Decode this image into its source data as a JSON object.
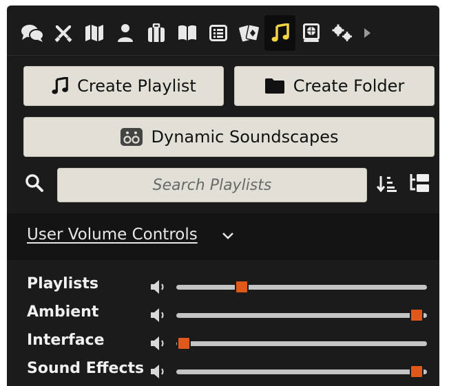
{
  "tabs": [
    {
      "name": "chat-messages-icon",
      "active": false
    },
    {
      "name": "combat-swords-icon",
      "active": false
    },
    {
      "name": "scenes-map-icon",
      "active": false
    },
    {
      "name": "actors-user-icon",
      "active": false
    },
    {
      "name": "items-suitcase-icon",
      "active": false
    },
    {
      "name": "journal-book-icon",
      "active": false
    },
    {
      "name": "tables-list-icon",
      "active": false
    },
    {
      "name": "cards-icon",
      "active": false
    },
    {
      "name": "playlists-music-icon",
      "active": true
    },
    {
      "name": "compendium-atlas-icon",
      "active": false
    },
    {
      "name": "settings-cogs-icon",
      "active": false
    },
    {
      "name": "more-tabs-arrow-icon",
      "active": false
    }
  ],
  "buttons": {
    "create_playlist": "Create Playlist",
    "create_folder": "Create Folder",
    "dynamic_soundscapes": "Dynamic Soundscapes"
  },
  "search": {
    "placeholder": "Search Playlists",
    "value": ""
  },
  "volume": {
    "title": "User Volume Controls",
    "channels": [
      {
        "label": "Playlists",
        "level": 0.26
      },
      {
        "label": "Ambient",
        "level": 0.96
      },
      {
        "label": "Interface",
        "level": 0.03
      },
      {
        "label": "Sound Effects",
        "level": 0.96
      }
    ]
  },
  "colors": {
    "background": "#1b1b1b",
    "button": "#e2e0d6",
    "active_tab": "#f5d442",
    "slider_thumb": "#e0581a",
    "slider_track": "#c4c4c4"
  }
}
